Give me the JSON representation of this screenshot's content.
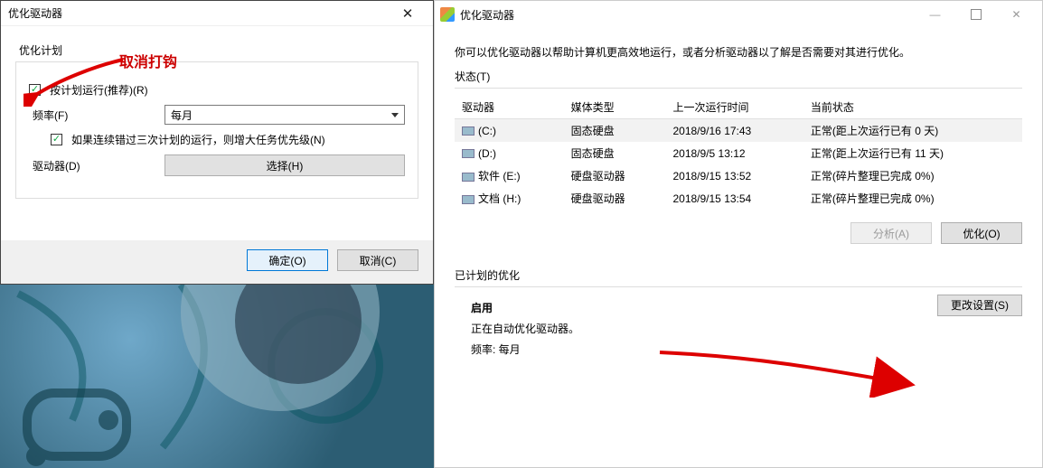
{
  "main_window": {
    "title": "优化驱动器",
    "description": "你可以优化驱动器以帮助计算机更高效地运行，或者分析驱动器以了解是否需要对其进行优化。",
    "status_header": "状态(T)",
    "columns": [
      "驱动器",
      "媒体类型",
      "上一次运行时间",
      "当前状态"
    ],
    "drives": [
      {
        "name": "(C:)",
        "media": "固态硬盘",
        "last": "2018/9/16 17:43",
        "status": "正常(距上次运行已有 0 天)",
        "selected": true
      },
      {
        "name": "(D:)",
        "media": "固态硬盘",
        "last": "2018/9/5 13:12",
        "status": "正常(距上次运行已有 11 天)",
        "selected": false
      },
      {
        "name": "软件 (E:)",
        "media": "硬盘驱动器",
        "last": "2018/9/15 13:52",
        "status": "正常(碎片整理已完成 0%)",
        "selected": false
      },
      {
        "name": "文档 (H:)",
        "media": "硬盘驱动器",
        "last": "2018/9/15 13:54",
        "status": "正常(碎片整理已完成 0%)",
        "selected": false
      }
    ],
    "analyze_btn": "分析(A)",
    "optimize_btn": "优化(O)",
    "sched_header": "已计划的优化",
    "sched_enabled": "启用",
    "sched_line1": "正在自动优化驱动器。",
    "sched_line2": "频率: 每月",
    "change_btn": "更改设置(S)"
  },
  "dialog": {
    "title": "优化驱动器",
    "plan_group": "优化计划",
    "run_on_schedule": "按计划运行(推荐)(R)",
    "freq_label": "频率(F)",
    "freq_value": "每月",
    "miss_label": "如果连续错过三次计划的运行，则增大任务优先级(N)",
    "drives_label": "驱动器(D)",
    "choose_btn": "选择(H)",
    "ok_btn": "确定(O)",
    "cancel_btn": "取消(C)"
  },
  "annotation": {
    "uncheck_text": "取消打钩"
  },
  "sys": {
    "minimize": "—",
    "close": "✕"
  }
}
